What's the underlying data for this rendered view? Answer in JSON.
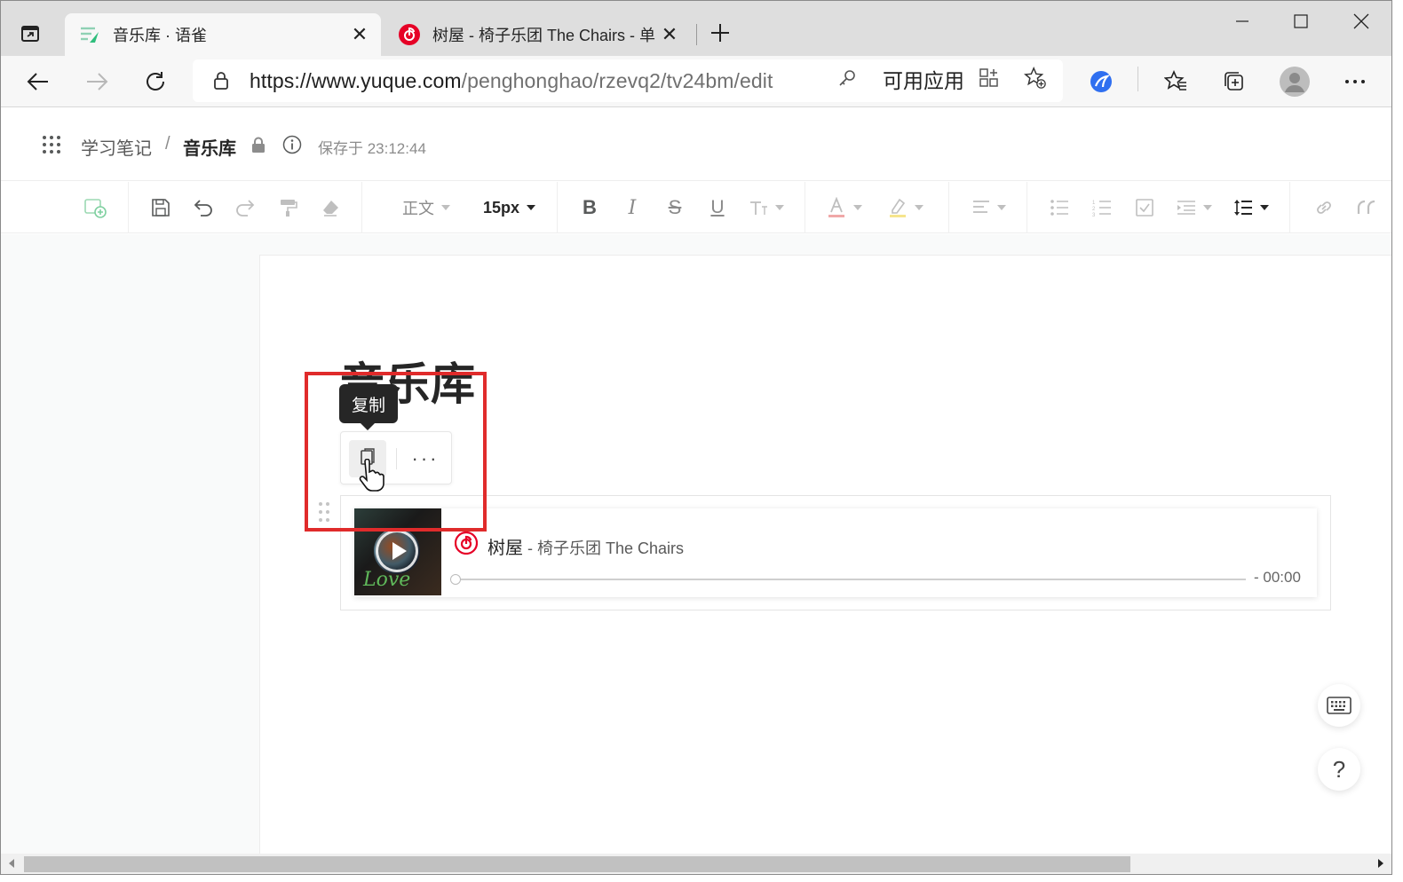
{
  "browser": {
    "tabs": [
      {
        "title": "音乐库 · 语雀",
        "active": true,
        "icon": "yuque-icon"
      },
      {
        "title": "树屋 - 椅子乐团 The Chairs - 单曲",
        "active": false,
        "icon": "netease-music-icon"
      }
    ],
    "url_host": "https://www.yuque.com",
    "url_path": "/penghonghao/rzevq2/tv24bm/edit",
    "apps_label": "可用应用"
  },
  "page": {
    "breadcrumb_parent": "学习笔记",
    "breadcrumb_sep": "/",
    "breadcrumb_current": "音乐库",
    "save_status": "保存于 23:12:44"
  },
  "editor_toolbar": {
    "paragraph_style": "正文",
    "font_size": "15px"
  },
  "document": {
    "title": "音乐库",
    "tooltip": "复制",
    "more_label": "···"
  },
  "player": {
    "song_title": "树屋",
    "song_sep": " - ",
    "artist": "椅子乐团 The Chairs",
    "time": "- 00:00",
    "cover_text": "Love",
    "progress": 0
  },
  "floating": {
    "help_label": "?"
  },
  "colors": {
    "highlight": "#e02b2b",
    "netease_red": "#e60026",
    "yuque_green": "#2fbe7c"
  }
}
